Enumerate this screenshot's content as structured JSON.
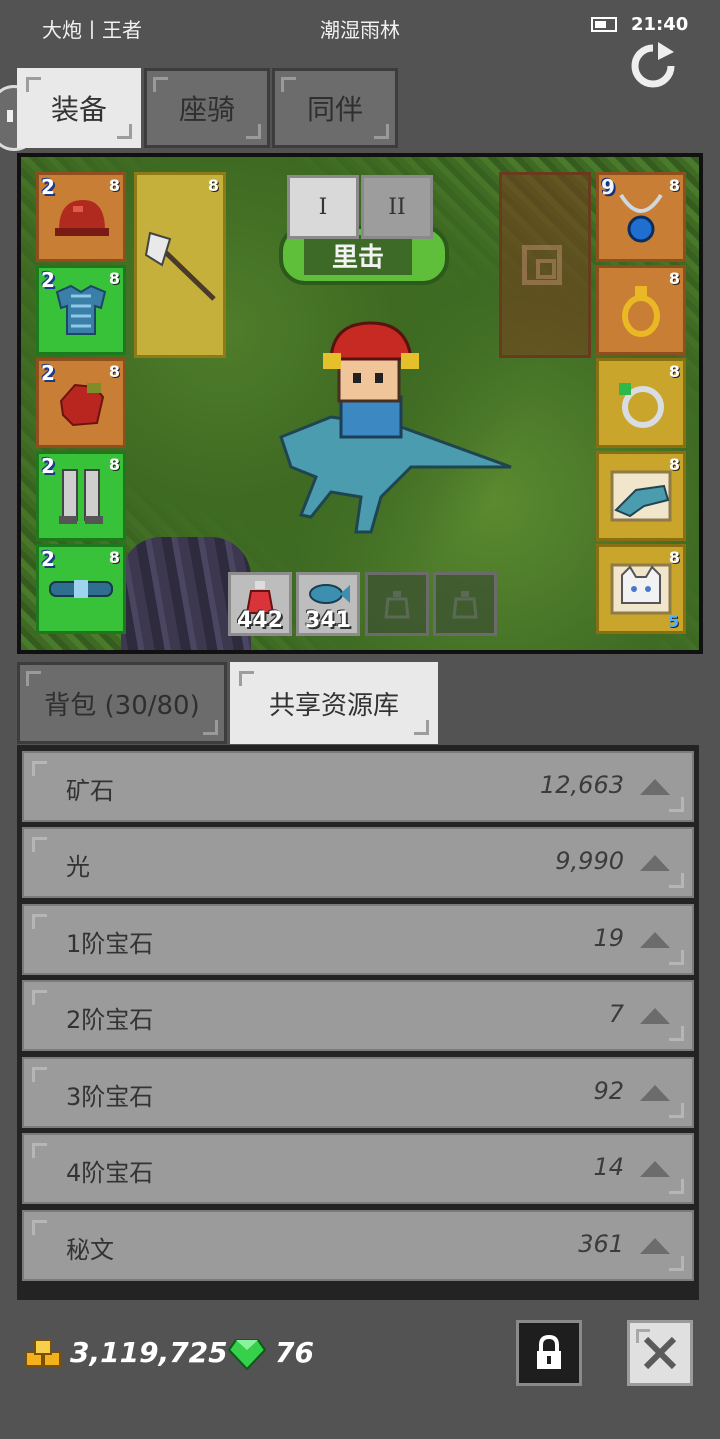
{
  "status_bar": {
    "left_text": "大炮丨王者",
    "center_text": "潮湿雨林",
    "time": "21:40"
  },
  "icons": {
    "refresh": "refresh-icon",
    "battery": "battery-icon"
  },
  "top_tabs": [
    {
      "label": "装备",
      "active": true
    },
    {
      "label": "座骑",
      "active": false
    },
    {
      "label": "同伴",
      "active": false
    }
  ],
  "scene": {
    "page_buttons": [
      "I",
      "II"
    ],
    "boss_label": "里击",
    "left_slots": [
      {
        "level": "2",
        "stars": "8",
        "item": "helmet"
      },
      {
        "level": "2",
        "stars": "8",
        "item": "armor"
      },
      {
        "level": "2",
        "stars": "8",
        "item": "gloves"
      },
      {
        "level": "2",
        "stars": "8",
        "item": "leggings"
      },
      {
        "level": "2",
        "stars": "8",
        "item": "belt"
      }
    ],
    "weapon_slot": {
      "stars": "8",
      "item": "axe"
    },
    "right_slots": [
      {
        "level": "9",
        "stars": "8",
        "item": "necklace"
      },
      {
        "level": "",
        "stars": "8",
        "item": "earring"
      },
      {
        "level": "",
        "stars": "8",
        "item": "ring"
      },
      {
        "level": "",
        "stars": "8",
        "item": "mount"
      },
      {
        "level": "",
        "stars": "8",
        "item": "pet-cat",
        "extra": "5"
      }
    ],
    "quick_slots": [
      {
        "count": "442",
        "item": "potion"
      },
      {
        "count": "341",
        "item": "fish"
      },
      {
        "count": "",
        "item": "empty"
      },
      {
        "count": "",
        "item": "empty"
      }
    ]
  },
  "bag_tabs": [
    {
      "label": "背包 (30/80)",
      "active": false
    },
    {
      "label": "共享资源库",
      "active": true
    }
  ],
  "resources": [
    {
      "name": "矿石",
      "value": "12,663"
    },
    {
      "name": "光",
      "value": "9,990"
    },
    {
      "name": "1阶宝石",
      "value": "19"
    },
    {
      "name": "2阶宝石",
      "value": "7"
    },
    {
      "name": "3阶宝石",
      "value": "92"
    },
    {
      "name": "4阶宝石",
      "value": "14"
    },
    {
      "name": "秘文",
      "value": "361"
    }
  ],
  "currency": {
    "gold": "3,119,725",
    "gems": "76"
  },
  "colors": {
    "background": "#535353",
    "gem_green": "#37d04a",
    "gold": "#f2b21e"
  }
}
